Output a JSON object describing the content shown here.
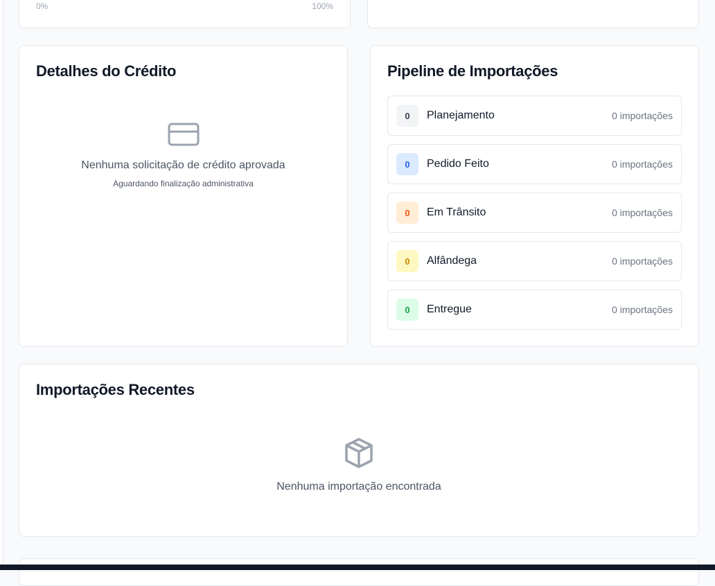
{
  "top_left_card": {
    "progress_min": "0%",
    "progress_max": "100%"
  },
  "credit_card": {
    "title": "Detalhes do Crédito",
    "empty_icon": "credit-card-icon",
    "empty_message": "Nenhuma solicitação de crédito aprovada",
    "empty_submessage": "Aguardando finalização administrativa"
  },
  "pipeline_card": {
    "title": "Pipeline de Importações",
    "stages": [
      {
        "count": "0",
        "label": "Planejamento",
        "meta": "0 importações",
        "badge_bg": "#f3f4f6",
        "badge_fg": "#374151"
      },
      {
        "count": "0",
        "label": "Pedido Feito",
        "meta": "0 importações",
        "badge_bg": "#dbeafe",
        "badge_fg": "#2563eb"
      },
      {
        "count": "0",
        "label": "Em Trânsito",
        "meta": "0 importações",
        "badge_bg": "#ffedd5",
        "badge_fg": "#ea580c"
      },
      {
        "count": "0",
        "label": "Alfândega",
        "meta": "0 importações",
        "badge_bg": "#fef9c3",
        "badge_fg": "#ca8a04"
      },
      {
        "count": "0",
        "label": "Entregue",
        "meta": "0 importações",
        "badge_bg": "#dcfce7",
        "badge_fg": "#16a34a"
      }
    ]
  },
  "recent_card": {
    "title": "Importações Recentes",
    "empty_icon": "package-icon",
    "empty_message": "Nenhuma importação encontrada"
  }
}
